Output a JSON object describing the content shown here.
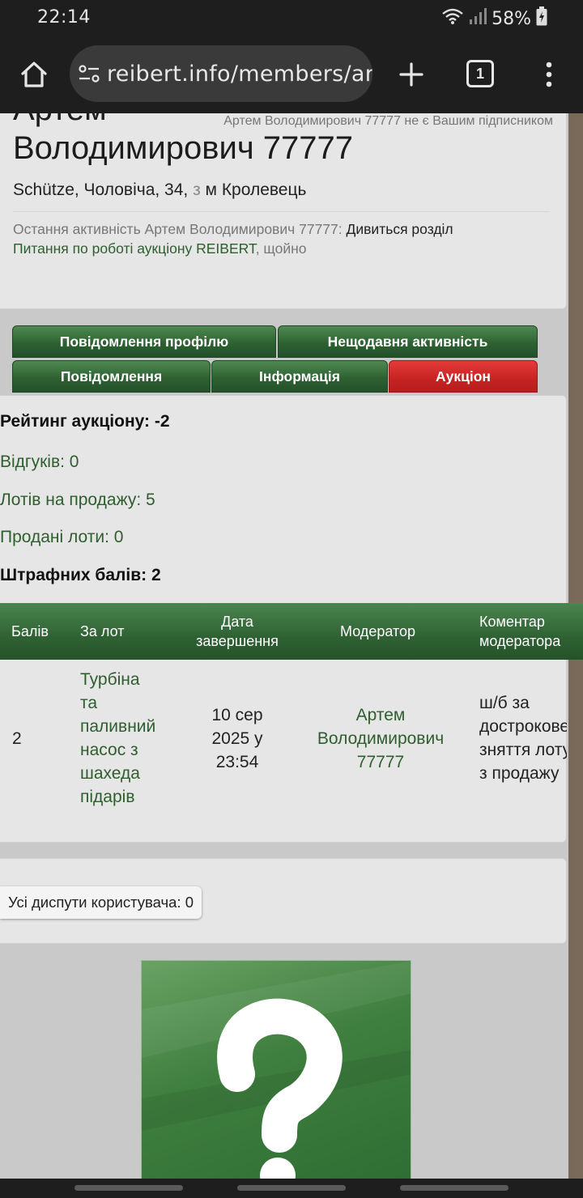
{
  "status_bar": {
    "time": "22:14",
    "battery": "58%",
    "icons": [
      "wifi-icon",
      "signal-icon",
      "battery-icon"
    ]
  },
  "browser": {
    "url": "reibert.info/members/ar",
    "tab_count": "1",
    "icons": [
      "home-icon",
      "site-info-icon",
      "new-tab-icon",
      "tabs-icon",
      "menu-icon"
    ]
  },
  "profile": {
    "name_line1": "Артем",
    "name_line2": "Володимирович 77777",
    "follow_status": "Артем Володимирович 77777 не є Вашим підписником",
    "subtitle_prefix": "Schütze, Чоловіча, 34, ",
    "subtitle_from": "з",
    "subtitle_city": " м Кролевець",
    "activity_label": "Остання активність Артем Володимирович 77777: ",
    "activity_action": "Дивиться розділ",
    "activity_link": "Питання по роботі аукціону REIBERT",
    "activity_time": ", щойно"
  },
  "tabs": {
    "profile_posts": "Повідомлення профілю",
    "recent_activity": "Нещодавня активність",
    "posts": "Повідомлення",
    "info": "Інформація",
    "auction": "Аукціон",
    "active": "auction"
  },
  "auction": {
    "rating": "Рейтинг аукціону: -2",
    "reviews": "Відгуків: 0",
    "lots_for_sale": "Лотів на продажу: 5",
    "sold_lots": "Продані лоти: 0",
    "penalty_points": "Штрафних балів: 2"
  },
  "penalty_table": {
    "headers": {
      "points": "Балів",
      "lot": "За лот",
      "end_date_1": "Дата",
      "end_date_2": "завершення",
      "moderator": "Модератор",
      "comment_1": "Коментар",
      "comment_2": "модератора"
    },
    "rows": [
      {
        "points": "2",
        "lot_lines": [
          "Турбіна",
          "та",
          "паливний",
          "насос з",
          "шахеда",
          "підарів"
        ],
        "date_lines": [
          "10 сер",
          "2025 у",
          "23:54"
        ],
        "moderator_lines": [
          "Артем",
          "Володимирович",
          "77777"
        ],
        "comment_lines": [
          "ш/б за",
          "дострокове",
          "зняття лоту",
          "з продажу"
        ]
      }
    ]
  },
  "disputes": {
    "label": "Усі диспути користувача: 0"
  },
  "avatar": {
    "glyph": "?"
  },
  "colors": {
    "accent_green": "#2e6132",
    "active_tab_red": "#c62323",
    "link_green": "#2e5e2e"
  }
}
